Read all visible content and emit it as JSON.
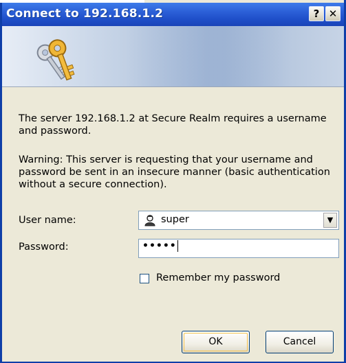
{
  "window": {
    "title": "Connect to 192.168.1.2",
    "help_label": "?",
    "close_label": "✕"
  },
  "banner": {
    "icon": "keys-icon"
  },
  "message": {
    "line1": "The server 192.168.1.2 at Secure Realm requires a username and password.",
    "warning": "Warning: This server is requesting that your username and password be sent in an insecure manner (basic authentication without a secure connection)."
  },
  "form": {
    "username_label": "User name:",
    "username_value": "super",
    "username_icon": "user-icon",
    "password_label": "Password:",
    "password_value": "•••••",
    "remember_label": "Remember my password",
    "remember_checked": false
  },
  "buttons": {
    "ok_label": "OK",
    "cancel_label": "Cancel"
  },
  "colors": {
    "titlebar": "#2b5fd7",
    "dialog_background": "#ece9d8",
    "field_border": "#7f9db9"
  }
}
